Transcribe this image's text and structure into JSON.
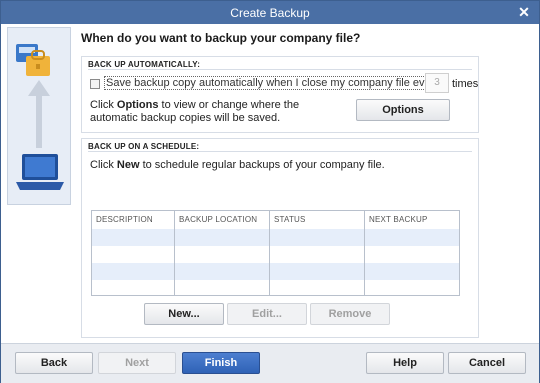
{
  "window": {
    "title": "Create Backup"
  },
  "heading": "When do you want to backup your company file?",
  "backup_auto": {
    "title": "BACK UP AUTOMATICALLY:",
    "checkbox_label": "Save backup copy automatically when I close my company file every",
    "times_value": "3",
    "times_label": "times",
    "options_text_pre": "Click ",
    "options_text_bold": "Options",
    "options_text_post": " to view or change where the automatic backup copies will be saved.",
    "options_button": "Options"
  },
  "schedule": {
    "title": "BACK UP ON A SCHEDULE:",
    "text_pre": "Click ",
    "text_bold": "New",
    "text_post": " to schedule regular backups of your company file.",
    "columns": [
      "DESCRIPTION",
      "BACKUP LOCATION",
      "STATUS",
      "NEXT BACKUP"
    ],
    "buttons": {
      "new": "New...",
      "edit": "Edit...",
      "remove": "Remove"
    }
  },
  "footer": {
    "back": "Back",
    "next": "Next",
    "finish": "Finish",
    "help": "Help",
    "cancel": "Cancel"
  },
  "colors": {
    "titlebar": "#4a6fa5",
    "primary": "#2f62b6",
    "row_alt": "#e6eefa"
  }
}
